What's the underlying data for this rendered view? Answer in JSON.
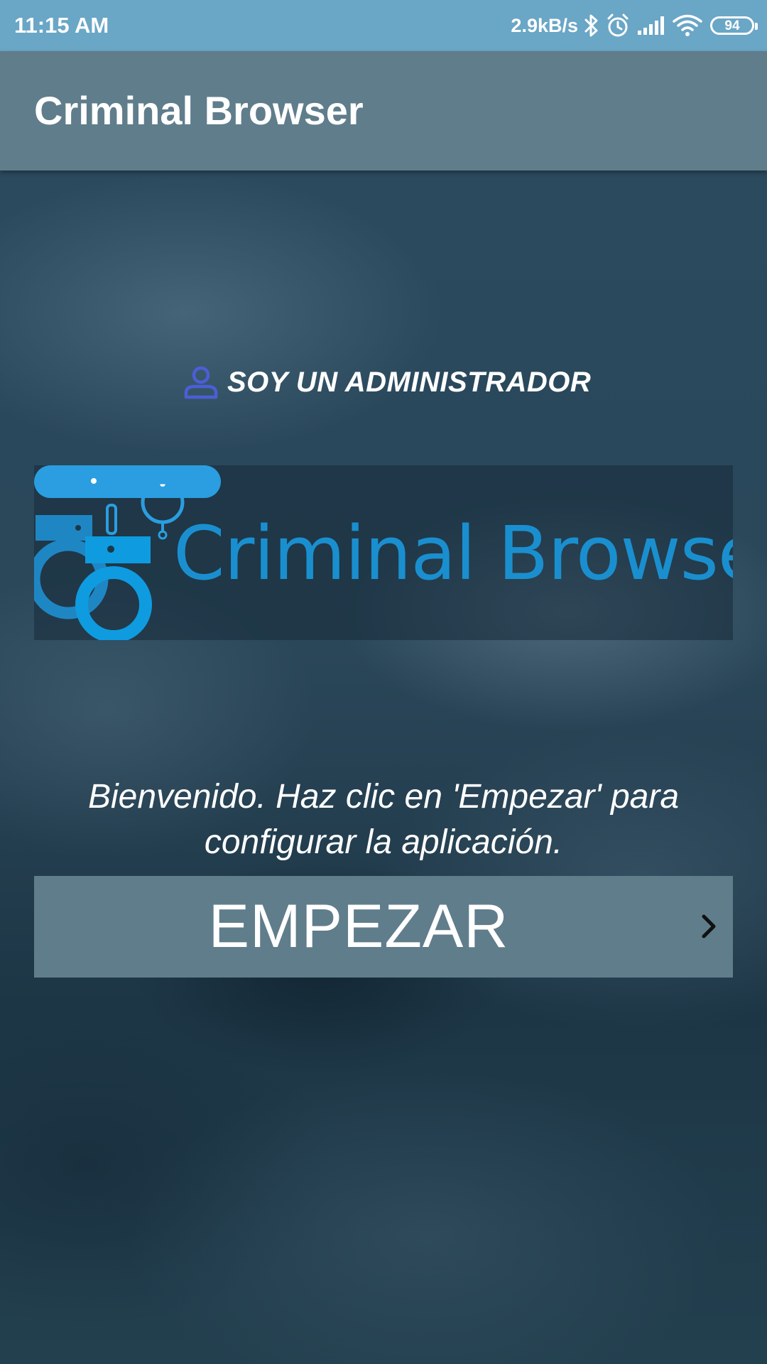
{
  "status_bar": {
    "time": "11:15 AM",
    "network_speed": "2.9kB/s",
    "battery_level": "94",
    "icons": [
      "bluetooth-icon",
      "alarm-icon",
      "signal-icon",
      "wifi-icon",
      "battery-icon"
    ]
  },
  "app_bar": {
    "title": "Criminal Browser"
  },
  "main": {
    "admin_link": {
      "icon": "person-icon",
      "label": "SOY UN ADMINISTRADOR",
      "icon_color": "#4a5fd6"
    },
    "logo": {
      "wordmark": "Criminal Browser",
      "brand_color": "#1a8fcf",
      "icon": "handcuffs-icon"
    },
    "welcome_message": "Bienvenido. Haz clic en 'Empezar' para configurar la aplicación.",
    "start_button": {
      "label": "EMPEZAR",
      "icon": "chevron-right-icon"
    }
  },
  "colors": {
    "status_bar": "#6aa6c6",
    "app_bar": "#607d8b",
    "button": "#607d8b",
    "text": "#ffffff"
  }
}
